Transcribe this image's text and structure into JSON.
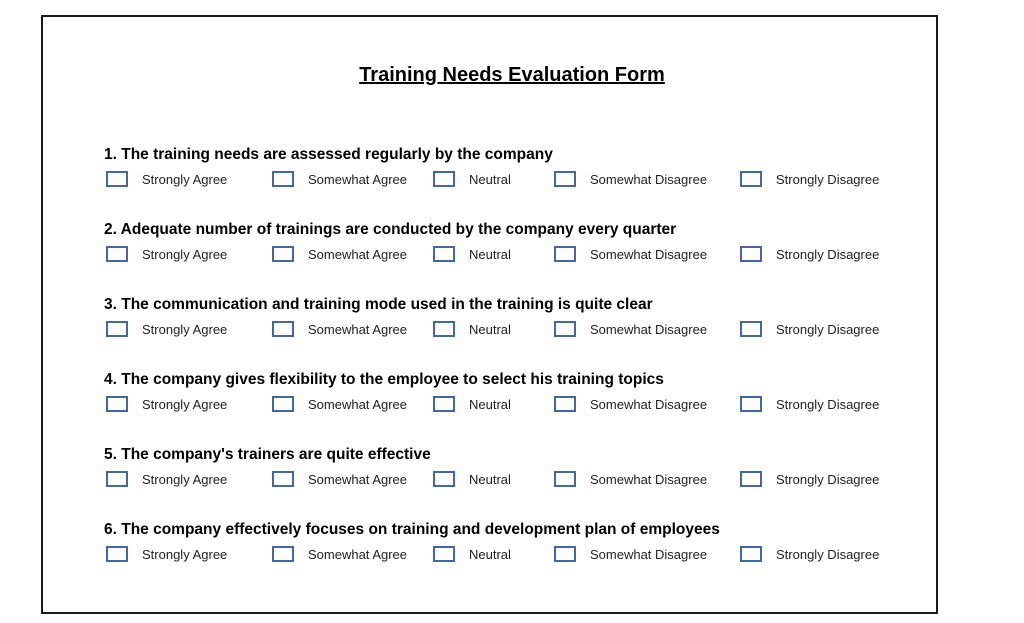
{
  "form": {
    "title": "Training Needs Evaluation Form",
    "options": [
      "Strongly Agree",
      "Somewhat Agree",
      "Neutral",
      "Somewhat Disagree",
      "Strongly Disagree"
    ],
    "checkbox_color": "#4267a6",
    "questions": [
      {
        "text": "1. The training needs are assessed regularly by the company",
        "checked": [
          false,
          false,
          false,
          false,
          false
        ]
      },
      {
        "text": "2. Adequate number of trainings are conducted by the company every quarter",
        "checked": [
          false,
          false,
          false,
          false,
          false
        ]
      },
      {
        "text": "3. The communication and training mode used in the training is quite clear",
        "checked": [
          false,
          false,
          false,
          false,
          false
        ]
      },
      {
        "text": "4. The company gives flexibility to the employee to select his training topics",
        "checked": [
          false,
          false,
          false,
          false,
          false
        ]
      },
      {
        "text": "5. The company's trainers are quite effective",
        "checked": [
          false,
          false,
          false,
          false,
          false
        ]
      },
      {
        "text": "6. The company effectively focuses on training and development plan of employees",
        "checked": [
          false,
          false,
          false,
          false,
          false
        ]
      }
    ]
  }
}
